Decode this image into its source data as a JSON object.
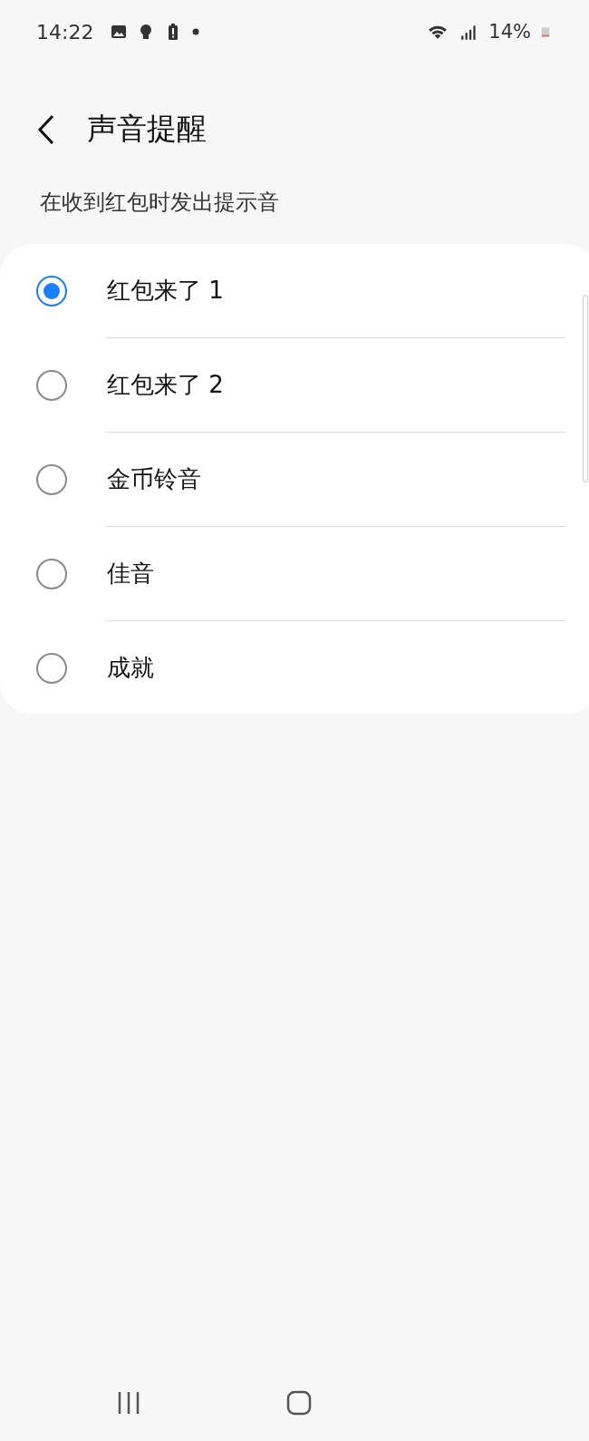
{
  "status_bar": {
    "time": "14:22",
    "battery": "14%"
  },
  "header": {
    "title": "声音提醒"
  },
  "description": "在收到红包时发出提示音",
  "options": [
    {
      "label": "红包来了 1",
      "selected": true
    },
    {
      "label": "红包来了 2",
      "selected": false
    },
    {
      "label": "金币铃音",
      "selected": false
    },
    {
      "label": "佳音",
      "selected": false
    },
    {
      "label": "成就",
      "selected": false
    }
  ]
}
